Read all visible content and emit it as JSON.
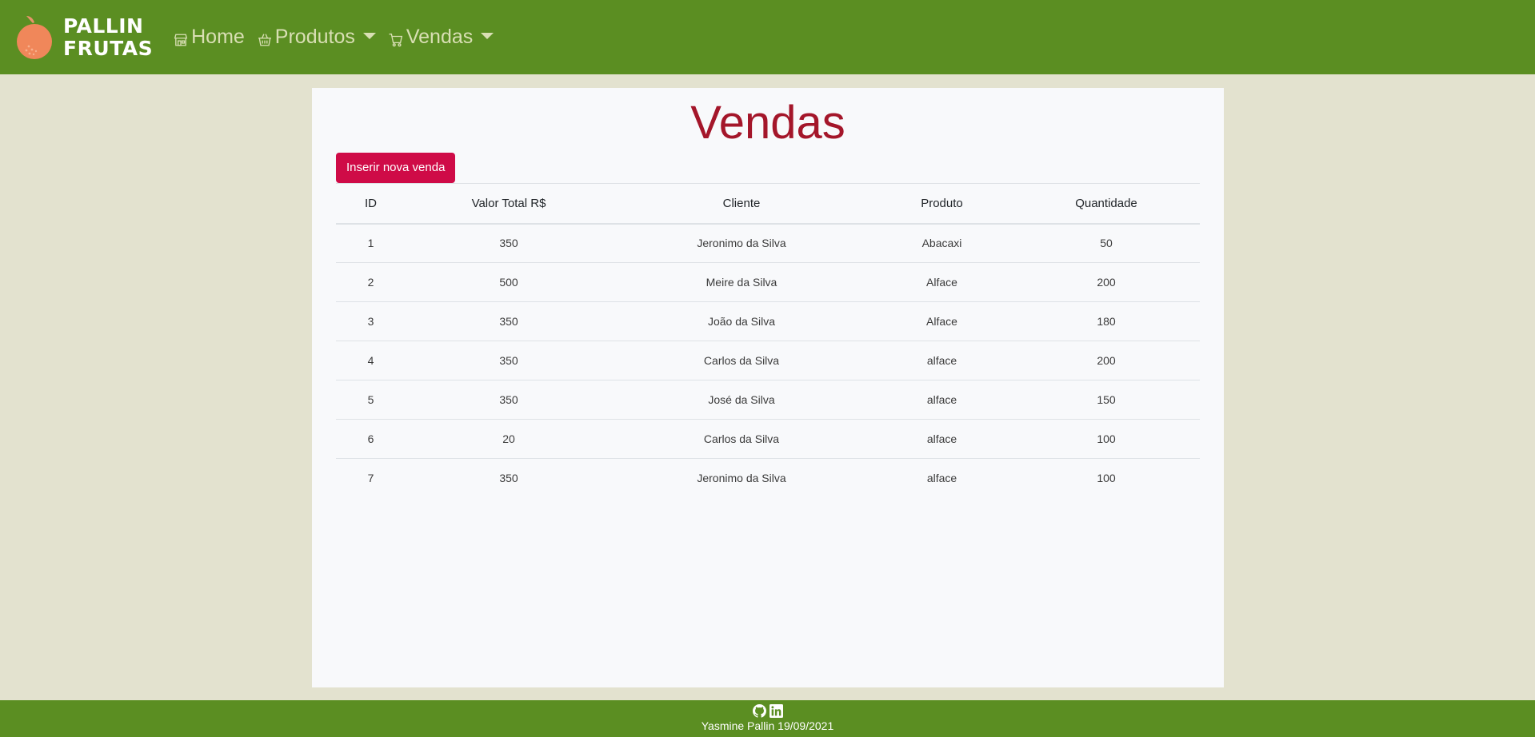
{
  "brand": {
    "line1": "PALLIN",
    "line2": "FRUTAS",
    "logo_icon": "orange-fruit-icon"
  },
  "nav": {
    "home": {
      "label": "Home",
      "icon": "store-icon"
    },
    "produtos": {
      "label": "Produtos",
      "icon": "basket-icon"
    },
    "vendas": {
      "label": "Vendas",
      "icon": "cart-icon"
    }
  },
  "page": {
    "title": "Vendas",
    "insert_button": "Inserir nova venda"
  },
  "table": {
    "headers": [
      "ID",
      "Valor Total R$",
      "Cliente",
      "Produto",
      "Quantidade"
    ],
    "rows": [
      [
        "1",
        "350",
        "Jeronimo da Silva",
        "Abacaxi",
        "50"
      ],
      [
        "2",
        "500",
        "Meire da Silva",
        "Alface",
        "200"
      ],
      [
        "3",
        "350",
        "João da Silva",
        "Alface",
        "180"
      ],
      [
        "4",
        "350",
        "Carlos da Silva",
        "alface",
        "200"
      ],
      [
        "5",
        "350",
        "José da Silva",
        "alface",
        "150"
      ],
      [
        "6",
        "20",
        "Carlos da Silva",
        "alface",
        "100"
      ],
      [
        "7",
        "350",
        "Jeronimo da Silva",
        "alface",
        "100"
      ]
    ]
  },
  "footer": {
    "icons": [
      "github-icon",
      "linkedin-icon"
    ],
    "text": "Yasmine Pallin 19/09/2021"
  },
  "colors": {
    "navbar": "#5b8e22",
    "background": "#e3e2cf",
    "title": "#a4162a",
    "button": "#cf0b47"
  }
}
